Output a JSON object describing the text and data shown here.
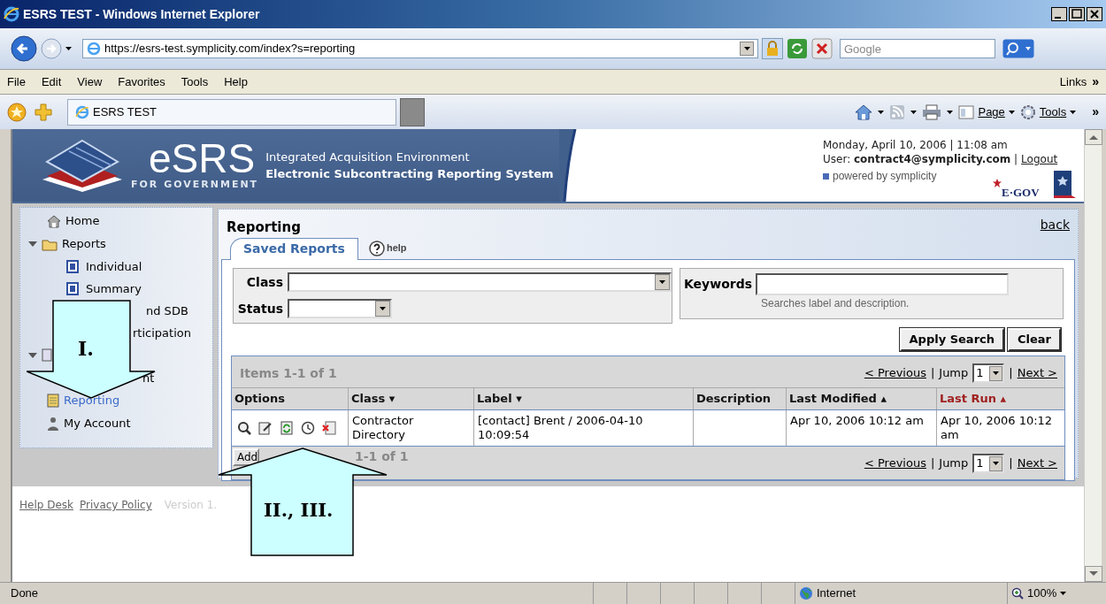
{
  "window": {
    "title": "ESRS TEST - Windows Internet Explorer"
  },
  "address_bar": {
    "url": "https://esrs-test.symplicity.com/index?s=reporting"
  },
  "search_box": {
    "placeholder": "Google"
  },
  "menu_bar": {
    "items": [
      "File",
      "Edit",
      "View",
      "Favorites",
      "Tools",
      "Help"
    ],
    "links": "Links",
    "overflow": "»"
  },
  "tab_bar": {
    "tabs": [
      {
        "label": "ESRS TEST",
        "selected": true
      }
    ],
    "tools": [
      "Page",
      "Tools"
    ],
    "overflow": "»"
  },
  "header": {
    "logo": "eSRS",
    "logo_sub": "FOR GOVERNMENT",
    "subtitle": "Integrated Acquisition Environment",
    "title": "Electronic Subcontracting Reporting System",
    "date": "Monday, April 10, 2006 | 11:08 am",
    "user_line": "User: **contract4@symplicity.com** |",
    "logout": "Logout",
    "powered_by": "powered by symplicity",
    "egov": "E·GOV"
  },
  "sidebar": {
    "items": [
      {
        "label": "Home",
        "selected": false
      },
      {
        "label": "Reports",
        "selected": false,
        "expanded": true,
        "children": [
          {
            "kind": "link",
            "label": "Individual",
            "selected": false
          },
          {
            "kind": "link",
            "label": "Summary",
            "selected": false
          },
          {
            "kind": "partial",
            "label": "nd SDB",
            "selected": false
          },
          {
            "kind": "partial",
            "label": "rticipation",
            "selected": false
          }
        ]
      },
      {
        "selected": false,
        "expanded": true,
        "children": [
          {
            "kind": "partial",
            "label": "nt",
            "selected": false
          }
        ]
      },
      {
        "label": "Reporting",
        "selected": true
      },
      {
        "label": "My Account",
        "selected": false
      }
    ]
  },
  "main": {
    "title": "Reporting",
    "back": "back",
    "tabs": [
      {
        "label": "Saved Reports",
        "selected": true
      }
    ],
    "help": "help",
    "filters": {
      "class_label": "Class",
      "status_label": "Status",
      "keywords_label": "Keywords",
      "keywords_hint": "Searches label and description."
    },
    "buttons": [
      "Apply Search",
      "Clear"
    ]
  },
  "table": {
    "items": "Items 1-1 of 1",
    "pagination": {
      "previous": "< Previous",
      "separator": "|",
      "jump": "Jump",
      "page": "1",
      "next": "Next >"
    },
    "columns": [
      {
        "label": "Options",
        "active": false
      },
      {
        "label": "Class",
        "sort": "▾",
        "active": false
      },
      {
        "label": "Label",
        "sort": "▾",
        "active": false
      },
      {
        "label": "Description",
        "active": false
      },
      {
        "label": "Last Modified",
        "sort": "▴",
        "active": false
      },
      {
        "label": "Last Run",
        "sort": "▴",
        "active": true
      }
    ],
    "rows": [
      {
        "cells": [
          "",
          "Contractor Directory",
          "[contact] Brent / 2006-04-10 10:09:54",
          "",
          "Apr 10, 2006 10:12 am",
          "Apr 10, 2006 10:12 am"
        ]
      }
    ],
    "footer": {
      "add": "Add",
      "items": "1-1 of 1",
      "pagination": {
        "previous": "< Previous",
        "separator": "|",
        "jump": "Jump",
        "page": "1",
        "next": "Next >"
      }
    }
  },
  "footer": {
    "links": [
      "Help Desk",
      "Privacy Policy"
    ],
    "version": "Version 1."
  },
  "annotations": [
    {
      "label": "I."
    },
    {
      "label": "II., III."
    }
  ],
  "status_bar": {
    "text": "Done",
    "zone": "Internet",
    "zoom": "100%"
  }
}
